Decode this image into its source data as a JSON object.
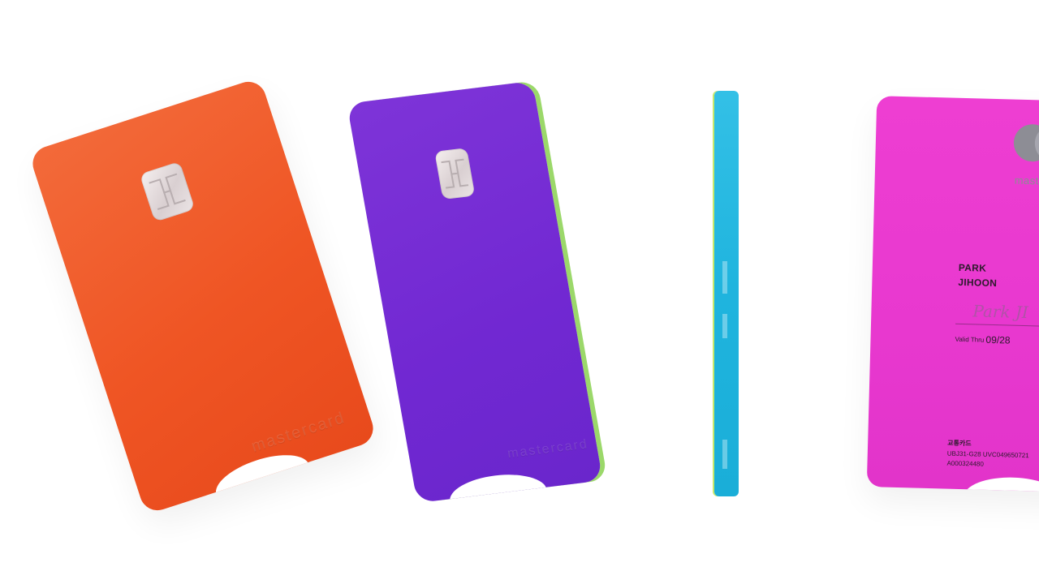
{
  "cards": {
    "orange": {
      "emboss_text": "mastercard",
      "color": "#ef5524"
    },
    "purple": {
      "emboss_text": "mastercard",
      "color": "#7128d2"
    },
    "blue": {
      "color": "#1fb4de"
    },
    "pink": {
      "color": "#e838cf",
      "network_text": "master",
      "holder_first_line": "PARK",
      "holder_second_line": "JIHOON",
      "signature": "Park JI",
      "valid_label": "Valid Thru",
      "valid_date": "09/28",
      "card_type_kr": "교통카드",
      "code_line_1": "UBJ31-G28 UVC049650721",
      "code_line_2": "A000324480"
    }
  }
}
